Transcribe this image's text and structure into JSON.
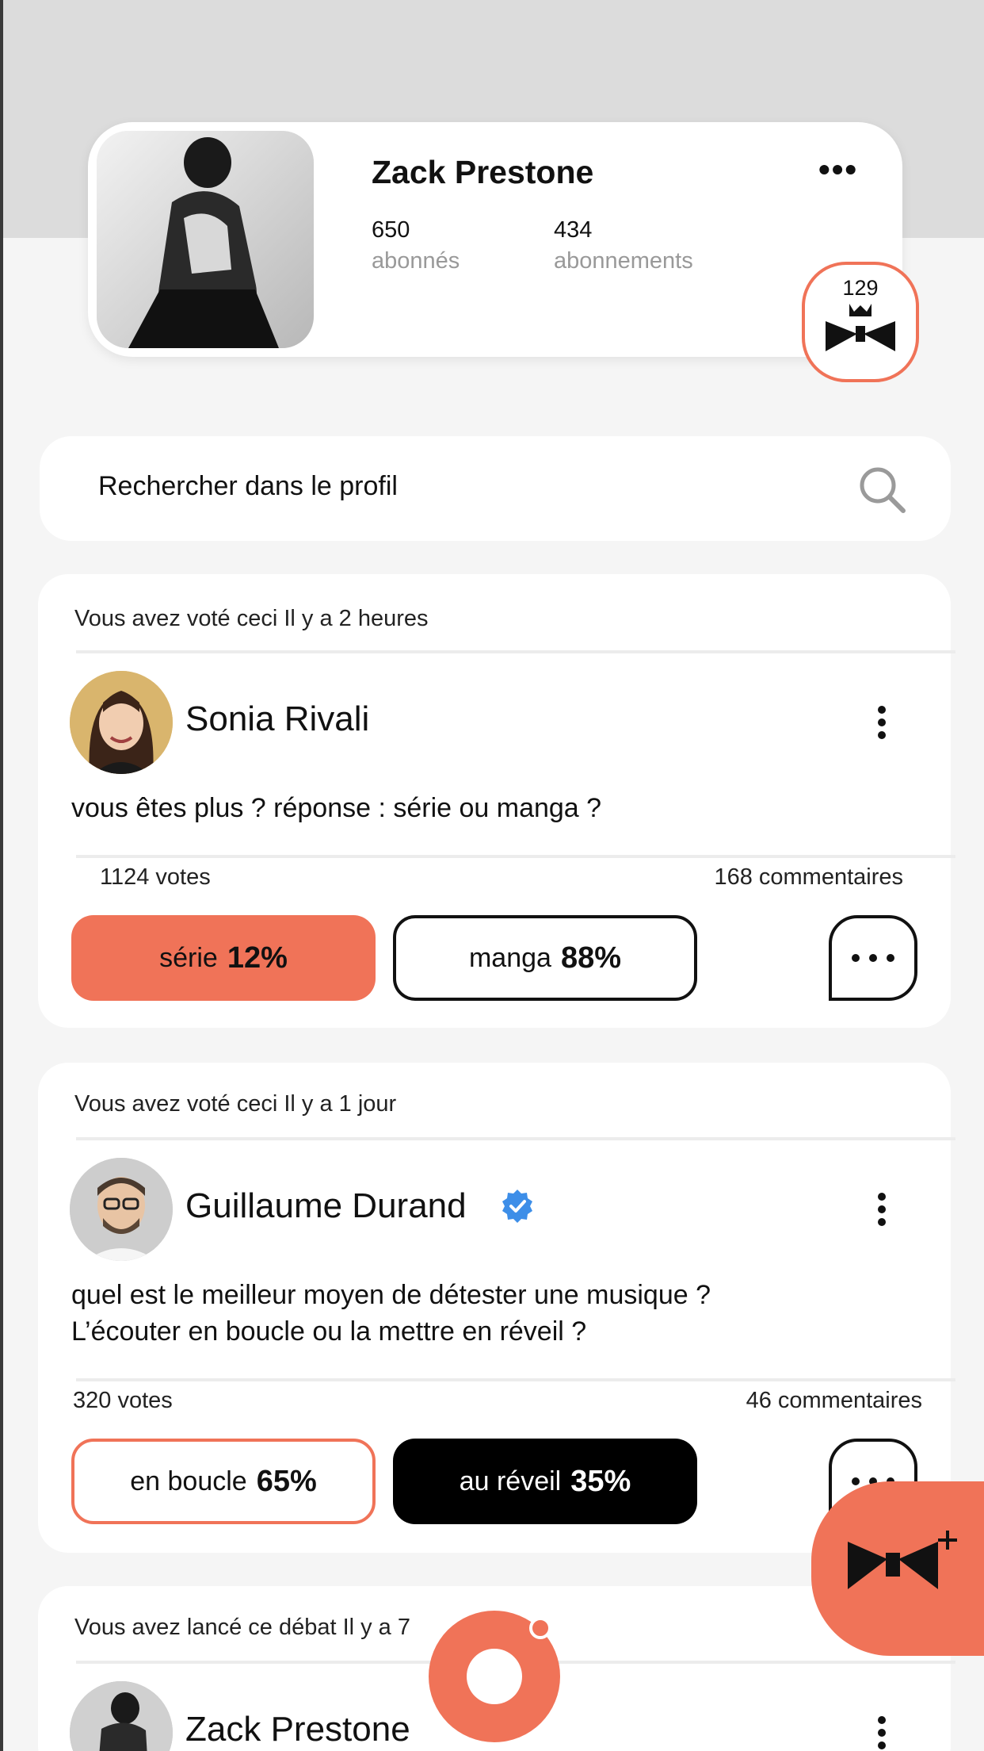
{
  "profile": {
    "name": "Zack Prestone",
    "followers_count": "650",
    "followers_label": "abonnés",
    "following_count": "434",
    "following_label": "abonnements",
    "badge_count": "129"
  },
  "search": {
    "placeholder": "Rechercher dans le profil"
  },
  "polls": [
    {
      "meta": "Vous avez voté ceci Il y a 2 heures",
      "author": "Sonia Rivali",
      "verified": false,
      "question": "vous êtes plus ? réponse : série ou manga ?",
      "votes": "1124 votes",
      "comments": "168 commentaires",
      "option_a": {
        "label": "série",
        "percent": "12%"
      },
      "option_b": {
        "label": "manga",
        "percent": "88%"
      }
    },
    {
      "meta": "Vous avez voté ceci Il y a 1 jour",
      "author": "Guillaume Durand",
      "verified": true,
      "question_line1": "quel est le meilleur moyen de détester une musique ?",
      "question_line2": "L’écouter en boucle ou la mettre en réveil ?",
      "votes": "320 votes",
      "comments": "46 commentaires",
      "option_a": {
        "label": "en boucle",
        "percent": "65%"
      },
      "option_b": {
        "label": "au réveil",
        "percent": "35%"
      }
    },
    {
      "meta": "Vous avez lancé ce débat Il y a 7",
      "author": "Zack Prestone"
    }
  ],
  "colors": {
    "accent": "#f07358",
    "verified": "#3d8ee8",
    "page_background": "#f5f5f5",
    "header_band": "#dcdcdc"
  },
  "icons": {
    "more": "more-horizontal-icon",
    "kebab": "more-vertical-icon",
    "search": "search-icon",
    "comment": "comment-bubble-icon",
    "crown": "crown-bowtie-icon",
    "create": "create-debate-icon",
    "verified": "verified-badge-icon"
  }
}
